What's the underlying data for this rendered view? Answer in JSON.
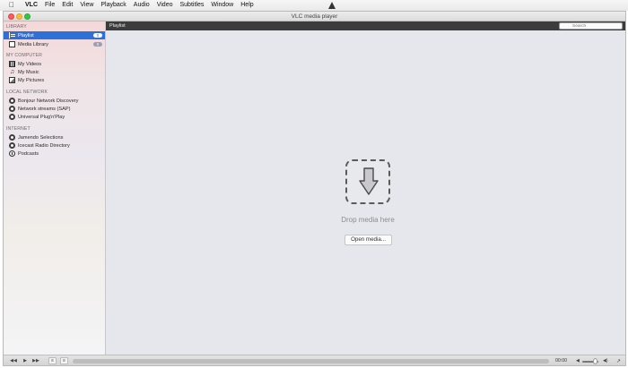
{
  "menubar": {
    "apple": "",
    "app_name": "VLC",
    "items": [
      "File",
      "Edit",
      "View",
      "Playback",
      "Audio",
      "Video",
      "Subtitles",
      "Window",
      "Help"
    ]
  },
  "window": {
    "title": "VLC media player"
  },
  "sidebar": {
    "sections": [
      {
        "title": "LIBRARY",
        "items": [
          {
            "label": "Playlist",
            "icon": "playlist-icon",
            "badge": "0",
            "selected": true
          },
          {
            "label": "Media Library",
            "icon": "media-library-icon",
            "badge": "0",
            "selected": false
          }
        ]
      },
      {
        "title": "MY COMPUTER",
        "items": [
          {
            "label": "My Videos",
            "icon": "video-icon"
          },
          {
            "label": "My Music",
            "icon": "music-note-icon"
          },
          {
            "label": "My Pictures",
            "icon": "pictures-icon"
          }
        ]
      },
      {
        "title": "LOCAL NETWORK",
        "items": [
          {
            "label": "Bonjour Network Discovery",
            "icon": "network-icon"
          },
          {
            "label": "Network streams (SAP)",
            "icon": "network-icon"
          },
          {
            "label": "Universal Plug'n'Play",
            "icon": "network-icon"
          }
        ]
      },
      {
        "title": "INTERNET",
        "items": [
          {
            "label": "Jamendo Selections",
            "icon": "network-icon"
          },
          {
            "label": "Icecast Radio Directory",
            "icon": "network-icon"
          },
          {
            "label": "Podcasts",
            "icon": "podcast-icon"
          }
        ]
      }
    ]
  },
  "main": {
    "header": "Playlist",
    "search_placeholder": "Search",
    "drop_text": "Drop media here",
    "open_button": "Open media..."
  },
  "controls": {
    "time": "00:00",
    "volume": 0.8
  },
  "colors": {
    "selection": "#2f6fd8",
    "header_bar": "#3c3c3c",
    "close": "#fc5b57",
    "minimize": "#fdbc2e",
    "maximize": "#33c748"
  }
}
